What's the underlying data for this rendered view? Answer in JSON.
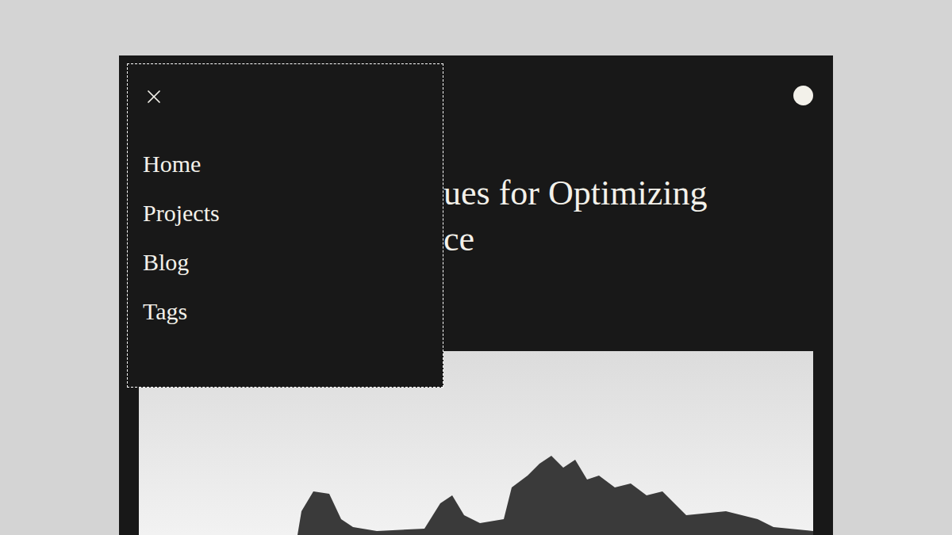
{
  "menu": {
    "open": true,
    "items": [
      {
        "label": "Home"
      },
      {
        "label": "Projects"
      },
      {
        "label": "Blog"
      },
      {
        "label": "Tags"
      }
    ]
  },
  "article": {
    "title_lines": [
      "ues for Optimizing",
      "ce"
    ]
  }
}
